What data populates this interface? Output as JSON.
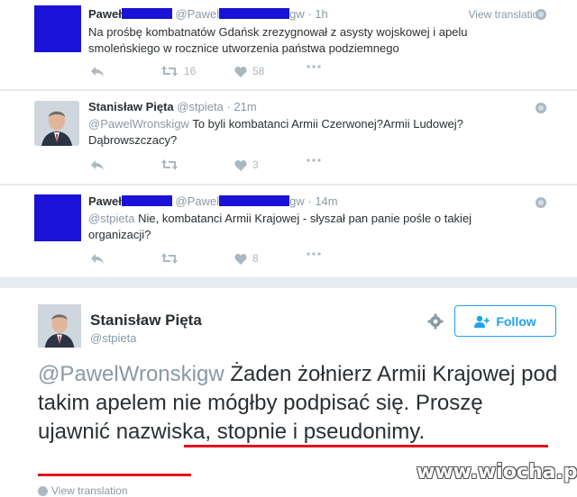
{
  "tweets": [
    {
      "name": "Paweł",
      "handle": "@Pawel",
      "handle_suffix": "gw",
      "time": "1h",
      "view_translation": "View translation",
      "text": "Na prośbę kombatnatów Gdańsk zrezygnował z asysty wojskowej i apelu smoleńskiego w rocznice utworzenia państwa podziemnego",
      "retweets": "16",
      "likes": "58",
      "avatar": "redacted"
    },
    {
      "name": "Stanisław Pięta",
      "handle": "@stpieta",
      "time": "21m",
      "mention": "@PawelWronskigw",
      "text": " To byli kombatanci Armii Czerwonej?Armii Ludowej? Dąbrowszczacy?",
      "retweets": "",
      "likes": "3",
      "avatar": "photo"
    },
    {
      "name": "Paweł",
      "handle": "@Pawel",
      "handle_suffix": "gw",
      "time": "14m",
      "mention": "@stpieta",
      "text": " Nie, kombatanci Armii Krajowej - słyszał pan panie pośle o takiej organizacji?",
      "retweets": "",
      "likes": "8",
      "avatar": "redacted"
    }
  ],
  "main_tweet": {
    "name": "Stanisław Pięta",
    "handle": "@stpieta",
    "follow_label": "Follow",
    "mention": "@PawelWronskigw",
    "text": " Żaden żołnierz Armii Krajowej pod takim apelem nie mógłby podpisać się. Proszę ujawnić nazwiska, stopnie i pseudonimy.",
    "view_translation": "View translation"
  },
  "watermark": "www.wiocha.pl",
  "colors": {
    "accent": "#1da1f2",
    "redaction": "#1a12d6",
    "underline": "#e3121d",
    "muted": "#8899a6"
  },
  "icons": [
    "reply-icon",
    "retweet-icon",
    "like-icon",
    "more-icon",
    "globe-icon",
    "gear-icon",
    "follow-user-icon"
  ]
}
